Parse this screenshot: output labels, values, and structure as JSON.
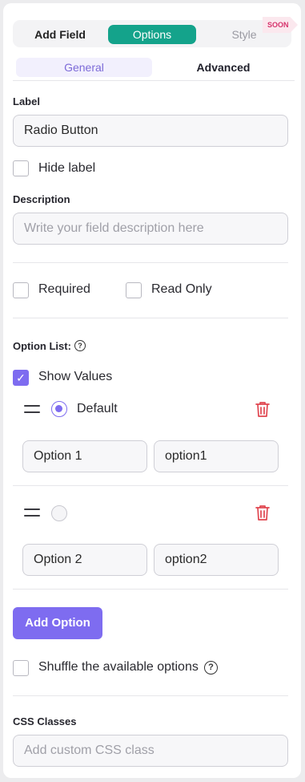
{
  "top_tabs": {
    "add_field": "Add Field",
    "options": "Options",
    "style": "Style",
    "soon_badge": "SOON"
  },
  "sub_tabs": {
    "general": "General",
    "advanced": "Advanced"
  },
  "label_section": {
    "label": "Label",
    "value": "Radio Button"
  },
  "hide_label": {
    "text": "Hide label",
    "checked": false
  },
  "description": {
    "label": "Description",
    "placeholder": "Write your field description here"
  },
  "required": {
    "text": "Required",
    "checked": false
  },
  "read_only": {
    "text": "Read Only",
    "checked": false
  },
  "option_list": {
    "label": "Option List:",
    "help_icon": "?"
  },
  "show_values": {
    "text": "Show Values",
    "checked": true,
    "check_icon": "✓"
  },
  "options": [
    {
      "label": "Default",
      "selected": true,
      "name": "Option 1",
      "value": "option1"
    },
    {
      "label": "",
      "selected": false,
      "name": "Option 2",
      "value": "option2"
    }
  ],
  "add_option_label": "Add Option",
  "shuffle": {
    "text": "Shuffle the available options",
    "checked": false,
    "help_icon": "?"
  },
  "css_classes": {
    "label": "CSS Classes",
    "placeholder": "Add custom CSS class"
  },
  "colors": {
    "accent": "#7e6cf0",
    "tab_active": "#14a38b",
    "danger": "#e0454f"
  }
}
